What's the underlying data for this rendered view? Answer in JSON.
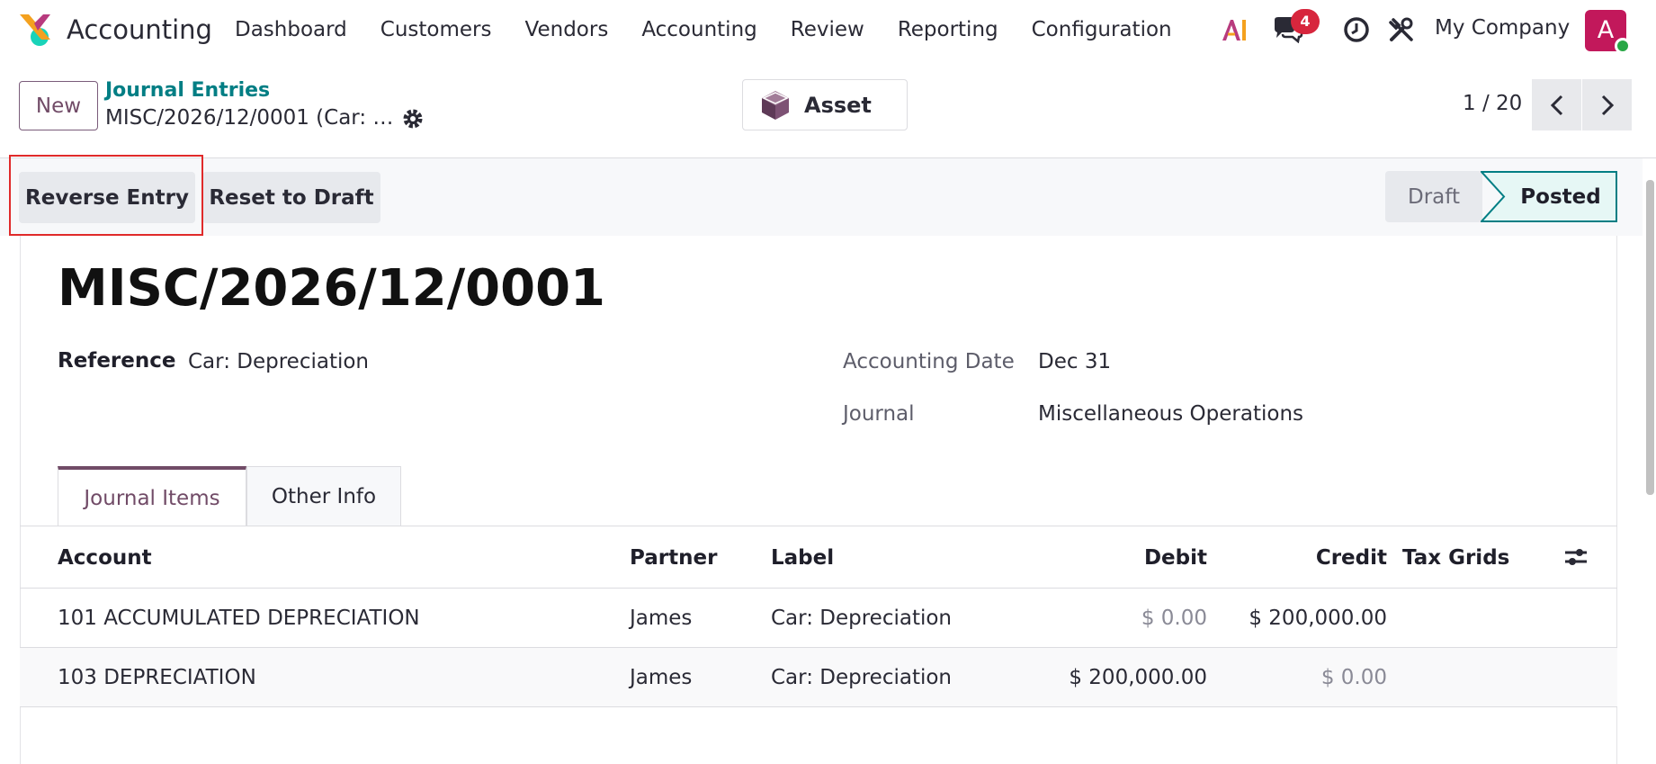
{
  "app": {
    "name": "Accounting",
    "menu": [
      "Dashboard",
      "Customers",
      "Vendors",
      "Accounting",
      "Review",
      "Reporting",
      "Configuration"
    ]
  },
  "systray": {
    "ai_icon": "ai-icon",
    "chat_icon": "chat-icon",
    "message_count": "4",
    "activity_icon": "clock-icon",
    "debug_icon": "tools-icon",
    "company": "My Company",
    "avatar_letter": "A"
  },
  "control": {
    "new_label": "New",
    "breadcrumb_parent": "Journal Entries",
    "breadcrumb_current": "MISC/2026/12/0001 (Car: …",
    "asset_label": "Asset",
    "pager": "1 / 20"
  },
  "statusbar": {
    "reverse_label": "Reverse Entry",
    "reset_label": "Reset to Draft",
    "stages": [
      "Draft",
      "Posted"
    ],
    "active_stage": "Posted"
  },
  "record": {
    "name": "MISC/2026/12/0001",
    "reference_label": "Reference",
    "reference": "Car: Depreciation",
    "date_label": "Accounting Date",
    "date": "Dec 31",
    "journal_label": "Journal",
    "journal": "Miscellaneous Operations"
  },
  "tabs": [
    "Journal Items",
    "Other Info"
  ],
  "table": {
    "headers": {
      "account": "Account",
      "partner": "Partner",
      "label": "Label",
      "debit": "Debit",
      "credit": "Credit",
      "tax_grids": "Tax Grids"
    },
    "rows": [
      {
        "account": "101 ACCUMULATED DEPRECIATION",
        "partner": "James",
        "label": "Car: Depreciation",
        "debit": "$ 0.00",
        "credit": "$ 200,000.00"
      },
      {
        "account": "103 DEPRECIATION",
        "partner": "James",
        "label": "Car: Depreciation",
        "debit": "$ 200,000.00",
        "credit": "$ 0.00"
      }
    ]
  },
  "colors": {
    "brand": "#714b67",
    "teal": "#017e84",
    "badge": "#d7263d",
    "highlight": "#e02a2a"
  }
}
